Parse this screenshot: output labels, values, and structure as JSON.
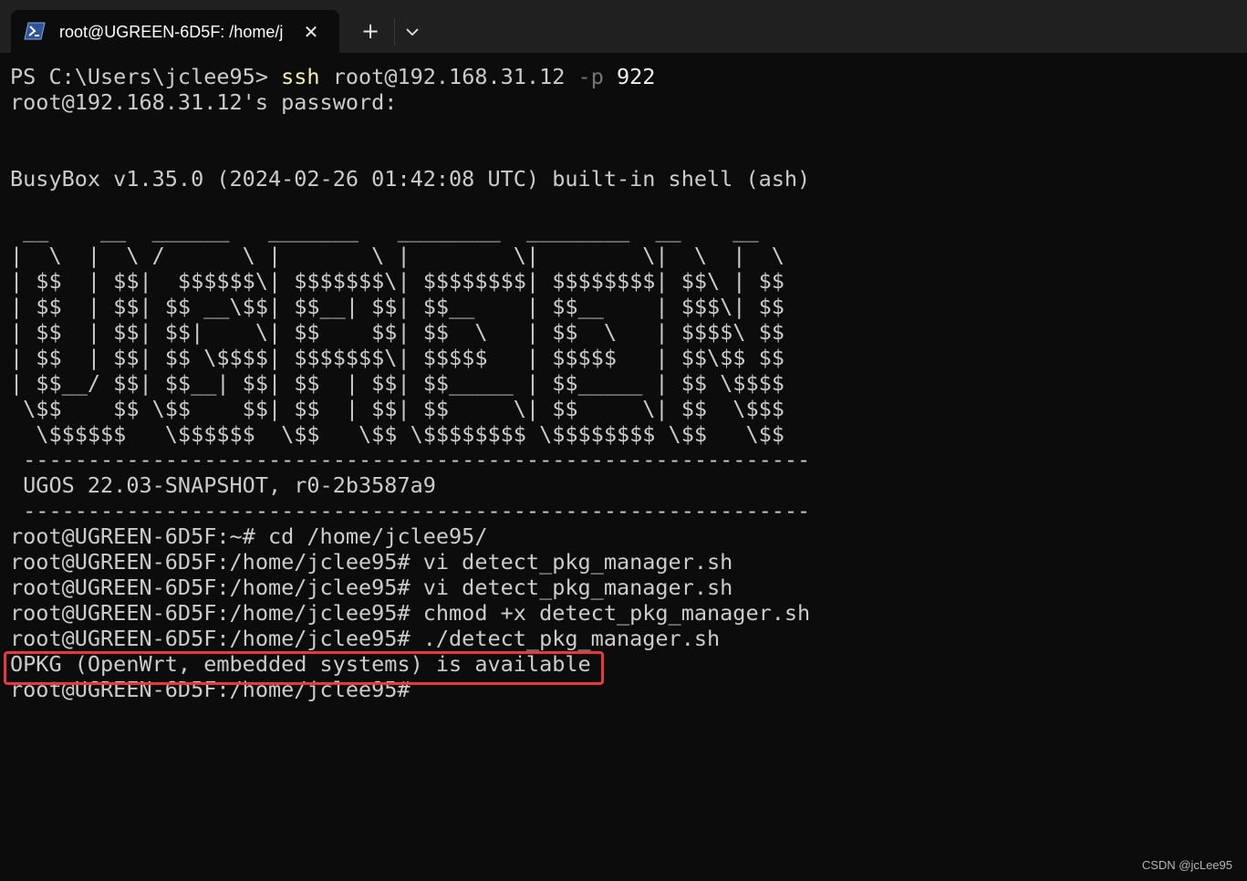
{
  "window": {
    "tab_title": "root@UGREEN-6D5F: /home/j",
    "tab_icon": "powershell-icon",
    "close_icon": "close-icon",
    "new_tab_symbol": "+",
    "dropdown_icon": "chevron-down-icon"
  },
  "terminal": {
    "ssh_line": {
      "prompt": "PS C:\\Users\\jclee95> ",
      "cmd": "ssh",
      "host": " root@192.168.31.12 ",
      "flag": "-p",
      "port": " 922"
    },
    "lines": [
      "root@192.168.31.12's password:",
      "",
      "",
      "BusyBox v1.35.0 (2024-02-26 01:42:08 UTC) built-in shell (ash)",
      "",
      " __    __  ______   _______   ________  ________  __    __",
      "|  \\  |  \\ /      \\ |       \\ |        \\|        \\|  \\  |  \\",
      "| $$  | $$|  $$$$$$\\| $$$$$$$\\| $$$$$$$$| $$$$$$$$| $$\\ | $$",
      "| $$  | $$| $$ __\\$$| $$__| $$| $$__    | $$__    | $$$\\| $$",
      "| $$  | $$| $$|    \\| $$    $$| $$  \\   | $$  \\   | $$$$\\ $$",
      "| $$  | $$| $$ \\$$$$| $$$$$$$\\| $$$$$   | $$$$$   | $$\\$$ $$",
      "| $$__/ $$| $$__| $$| $$  | $$| $$_____ | $$_____ | $$ \\$$$$",
      " \\$$    $$ \\$$    $$| $$  | $$| $$     \\| $$     \\| $$  \\$$$",
      "  \\$$$$$$   \\$$$$$$  \\$$   \\$$ \\$$$$$$$$ \\$$$$$$$$ \\$$   \\$$",
      " -------------------------------------------------------------",
      " UGOS 22.03-SNAPSHOT, r0-2b3587a9",
      " -------------------------------------------------------------",
      "root@UGREEN-6D5F:~# cd /home/jclee95/",
      "root@UGREEN-6D5F:/home/jclee95# vi detect_pkg_manager.sh",
      "root@UGREEN-6D5F:/home/jclee95# vi detect_pkg_manager.sh",
      "root@UGREEN-6D5F:/home/jclee95# chmod +x detect_pkg_manager.sh",
      "root@UGREEN-6D5F:/home/jclee95# ./detect_pkg_manager.sh",
      "OPKG (OpenWrt, embedded systems) is available",
      "root@UGREEN-6D5F:/home/jclee95#"
    ]
  },
  "watermark": "CSDN @jcLee95",
  "colors": {
    "background": "#0c0c0c",
    "titlebar": "#202020",
    "text": "#cccccc",
    "command_yellow": "#f9f1a5",
    "flag_gray": "#767676",
    "highlight_red": "#e8383d"
  }
}
